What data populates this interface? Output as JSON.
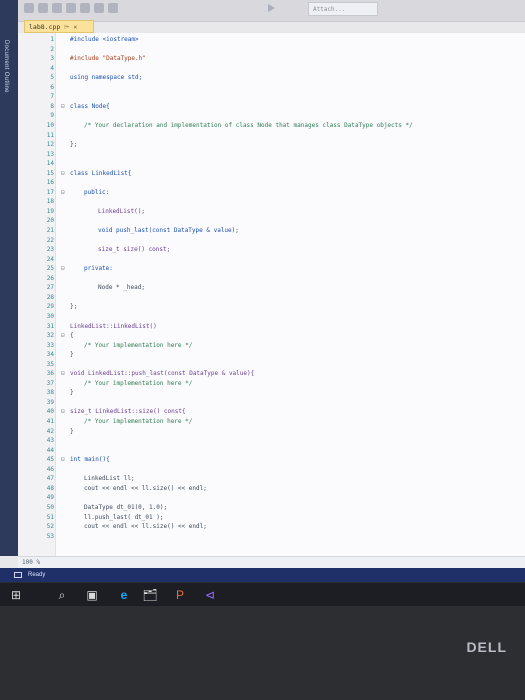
{
  "window": {
    "tab_title": "lab8.cpp",
    "tab_pin": "⌲",
    "tab_close": "×",
    "sidebar_label": "Document Outline",
    "search_text": "Attach..."
  },
  "editor": {
    "lines": [
      {
        "n": "1",
        "code": "#include <iostream>",
        "cls": "kw"
      },
      {
        "n": "2",
        "code": ""
      },
      {
        "n": "3",
        "code": "#include \"DataType.h\"",
        "cls": "str"
      },
      {
        "n": "4",
        "code": ""
      },
      {
        "n": "5",
        "code": "using namespace std;",
        "cls": "kw"
      },
      {
        "n": "6",
        "code": ""
      },
      {
        "n": "7",
        "code": ""
      },
      {
        "n": "8",
        "code": "class Node{",
        "fold": "⊟",
        "cls": "kw"
      },
      {
        "n": "9",
        "code": ""
      },
      {
        "n": "10",
        "code": "/* Your declaration and implementation of class Node that manages class DataType objects */",
        "cls": "comment",
        "indent": 1
      },
      {
        "n": "11",
        "code": ""
      },
      {
        "n": "12",
        "code": "};",
        "cls": ""
      },
      {
        "n": "13",
        "code": ""
      },
      {
        "n": "14",
        "code": ""
      },
      {
        "n": "15",
        "code": "class LinkedList{",
        "fold": "⊟",
        "cls": "kw"
      },
      {
        "n": "16",
        "code": ""
      },
      {
        "n": "17",
        "code": "public:",
        "fold": "⊟",
        "cls": "kw",
        "indent": 1
      },
      {
        "n": "18",
        "code": ""
      },
      {
        "n": "19",
        "code": "LinkedList();",
        "cls": "fn",
        "indent": 2
      },
      {
        "n": "20",
        "code": ""
      },
      {
        "n": "21",
        "code": "void push_last(const DataType & value);",
        "cls": "kw",
        "indent": 2
      },
      {
        "n": "22",
        "code": ""
      },
      {
        "n": "23",
        "code": "size_t size() const;",
        "cls": "fn",
        "indent": 2
      },
      {
        "n": "24",
        "code": ""
      },
      {
        "n": "25",
        "code": "private:",
        "fold": "⊟",
        "cls": "kw",
        "indent": 1
      },
      {
        "n": "26",
        "code": ""
      },
      {
        "n": "27",
        "code": "Node * _head;",
        "cls": "",
        "indent": 2
      },
      {
        "n": "28",
        "code": ""
      },
      {
        "n": "29",
        "code": "};",
        "cls": ""
      },
      {
        "n": "30",
        "code": ""
      },
      {
        "n": "31",
        "code": "LinkedList::LinkedList()",
        "cls": "fn"
      },
      {
        "n": "32",
        "code": "{",
        "fold": "⊟",
        "cls": ""
      },
      {
        "n": "33",
        "code": "/* Your implementation here */",
        "cls": "comment",
        "indent": 1
      },
      {
        "n": "34",
        "code": "}",
        "cls": ""
      },
      {
        "n": "35",
        "code": ""
      },
      {
        "n": "36",
        "code": "void LinkedList::push_last(const DataType & value){",
        "fold": "⊟",
        "cls": "fn"
      },
      {
        "n": "37",
        "code": "/* Your implementation here */",
        "cls": "comment",
        "indent": 1
      },
      {
        "n": "38",
        "code": "}",
        "cls": ""
      },
      {
        "n": "39",
        "code": ""
      },
      {
        "n": "40",
        "code": "size_t LinkedList::size() const{",
        "fold": "⊟",
        "cls": "fn"
      },
      {
        "n": "41",
        "code": "/* Your implementation here */",
        "cls": "comment",
        "indent": 1
      },
      {
        "n": "42",
        "code": "}",
        "cls": ""
      },
      {
        "n": "43",
        "code": ""
      },
      {
        "n": "44",
        "code": ""
      },
      {
        "n": "45",
        "code": "int main(){",
        "fold": "⊟",
        "cls": "kw"
      },
      {
        "n": "46",
        "code": ""
      },
      {
        "n": "47",
        "code": "LinkedList ll;",
        "cls": "",
        "indent": 1
      },
      {
        "n": "48",
        "code": "cout << endl << ll.size() << endl;",
        "cls": "",
        "indent": 1
      },
      {
        "n": "49",
        "code": ""
      },
      {
        "n": "50",
        "code": "DataType dt_01(0, 1.0);",
        "cls": "",
        "indent": 1
      },
      {
        "n": "51",
        "code": "ll.push_last( dt_01 );",
        "cls": "",
        "indent": 1
      },
      {
        "n": "52",
        "code": "cout << endl << ll.size() << endl;",
        "cls": "",
        "indent": 1
      },
      {
        "n": "53",
        "code": ""
      }
    ],
    "zoom": "100 %"
  },
  "status": {
    "text": "Ready"
  },
  "taskbar": {
    "start": "⊞",
    "search": "⌕",
    "taskview": "▣",
    "edge": "e",
    "explorer": "🗂",
    "powerpoint": "P",
    "visualstudio": "⊲"
  },
  "bezel": {
    "brand": "DELL"
  }
}
